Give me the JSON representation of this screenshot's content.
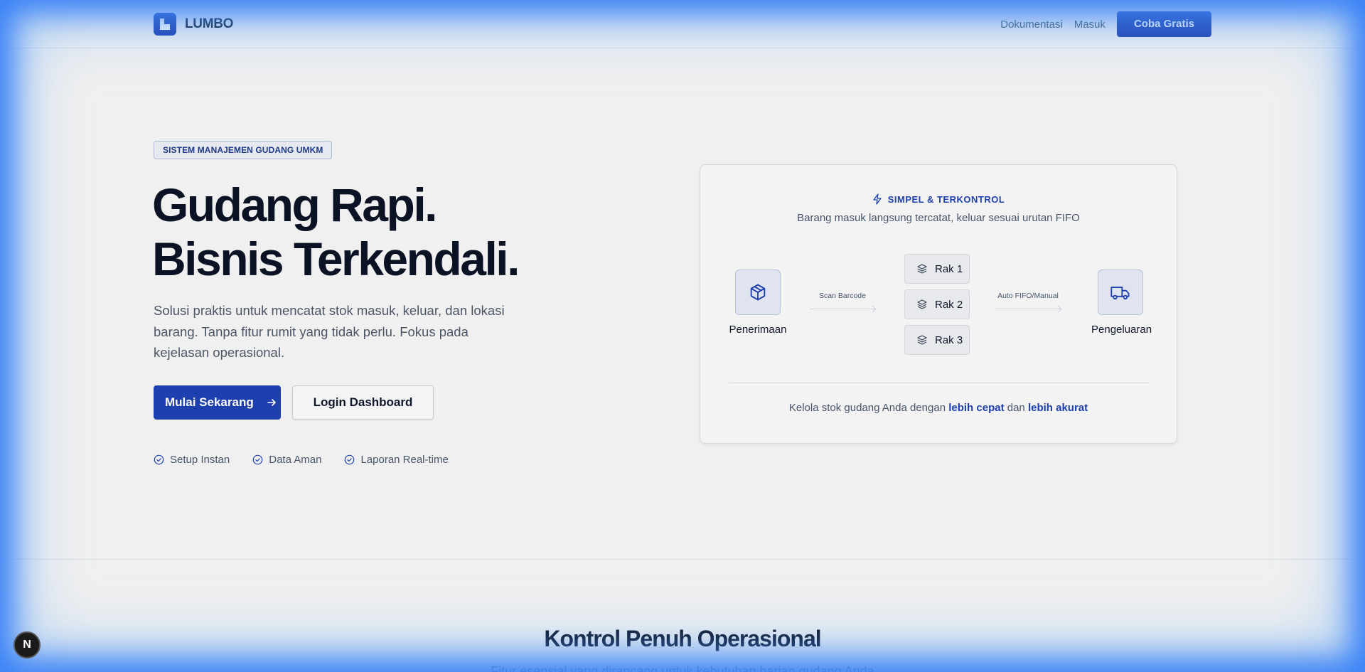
{
  "header": {
    "brand": "LUMBO",
    "nav": [
      "Dokumentasi",
      "Masuk"
    ],
    "cta": "Coba Gratis"
  },
  "hero": {
    "badge": "SISTEM MANAJEMEN GUDANG UMKM",
    "title_line1": "Gudang Rapi.",
    "title_line2": "Bisnis Terkendali.",
    "subtitle": "Solusi praktis untuk mencatat stok masuk, keluar, dan lokasi barang. Tanpa fitur rumit yang tidak perlu. Fokus pada kejelasan operasional.",
    "primary_button": "Mulai Sekarang",
    "secondary_button": "Login Dashboard",
    "features": [
      "Setup Instan",
      "Data Aman",
      "Laporan Real-time"
    ]
  },
  "flow_card": {
    "tag": "SIMPEL & TERKONTROL",
    "description": "Barang masuk langsung tercatat, keluar sesuai urutan FIFO",
    "inbound": "Penerimaan",
    "step1": "Scan Barcode",
    "racks": [
      "Rak 1",
      "Rak 2",
      "Rak 3"
    ],
    "step2": "Auto FIFO/Manual",
    "outbound": "Pengeluaran",
    "footer_prefix": "Kelola stok gudang Anda dengan",
    "footer_em1": "lebih cepat",
    "footer_mid": "dan",
    "footer_em2": "lebih akurat"
  },
  "section": {
    "title": "Kontrol Penuh Operasional",
    "subtitle": "Fitur esensial yang dirancang untuk kebutuhan harian gudang Anda"
  },
  "dev_badge": "N",
  "colors": {
    "accent": "#1e40af",
    "glow": "#3b82f6"
  }
}
